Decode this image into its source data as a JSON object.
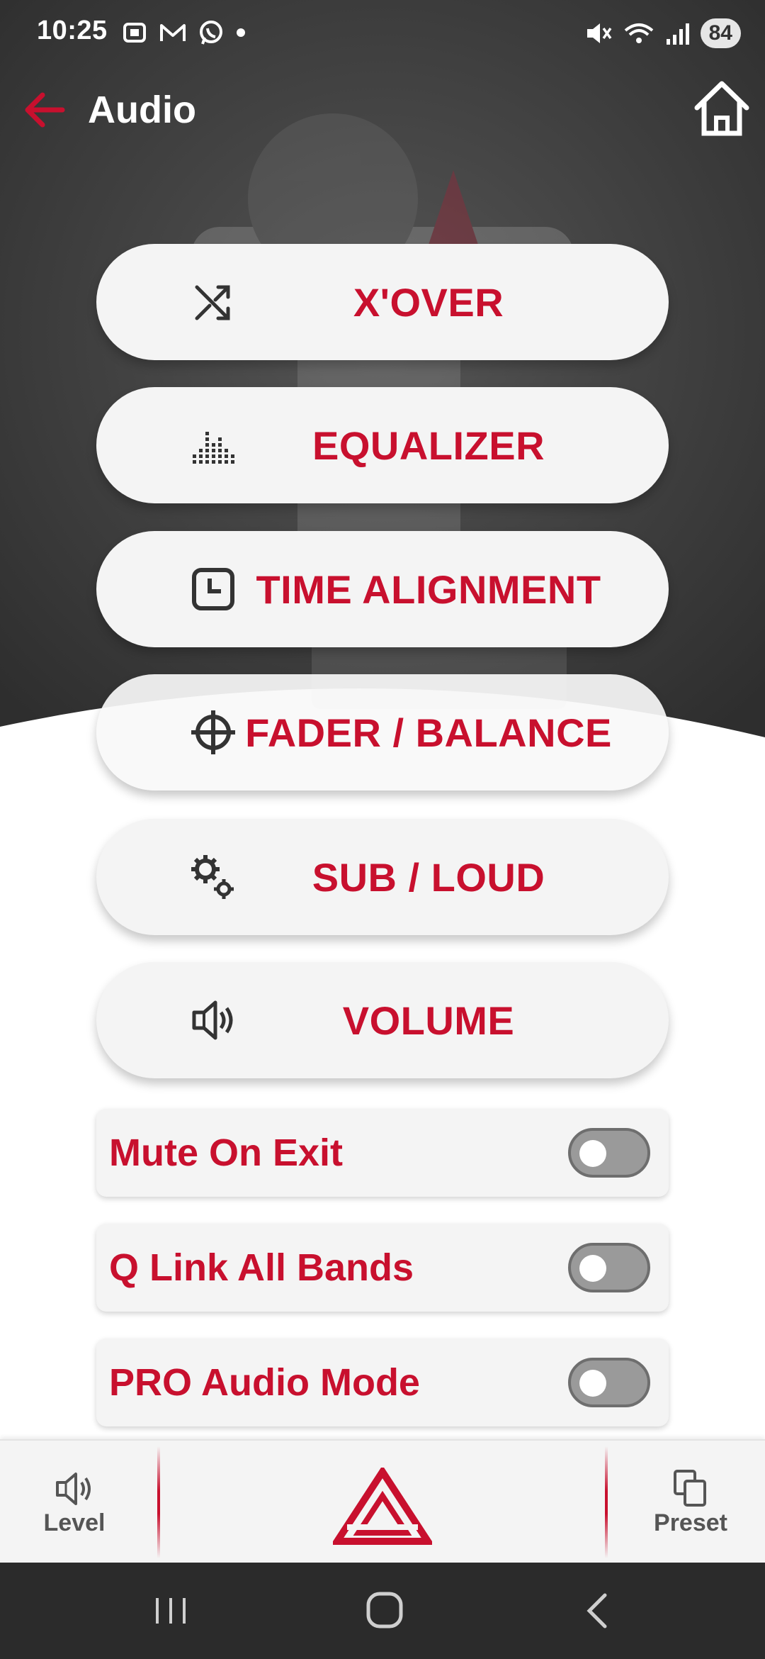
{
  "status_bar": {
    "time": "10:25",
    "battery": "84",
    "notification_icons": [
      "screenshot-icon",
      "gmail-icon",
      "whatsapp-icon",
      "dot-icon"
    ],
    "system_icons": [
      "mute-icon",
      "wifi-icon",
      "signal-icon"
    ]
  },
  "app_bar": {
    "title": "Audio",
    "back_icon": "back-arrow-icon",
    "home_icon": "home-icon"
  },
  "menu": [
    {
      "label": "X'OVER",
      "icon": "shuffle-icon"
    },
    {
      "label": "EQUALIZER",
      "icon": "equalizer-icon"
    },
    {
      "label": "TIME ALIGNMENT",
      "icon": "clock-icon"
    },
    {
      "label": "FADER / BALANCE",
      "icon": "crosshair-icon"
    },
    {
      "label": "SUB / LOUD",
      "icon": "gears-icon"
    },
    {
      "label": "VOLUME",
      "icon": "speaker-icon"
    }
  ],
  "toggles": [
    {
      "label": "Mute On Exit",
      "on": false
    },
    {
      "label": "Q Link All Bands",
      "on": false
    },
    {
      "label": "PRO Audio Mode",
      "on": false
    }
  ],
  "bottom_bar": {
    "level_label": "Level",
    "preset_label": "Preset",
    "center_icon": "triangle-logo-icon"
  },
  "nav_bar": {
    "recents_icon": "recents-icon",
    "home_icon": "nav-home-icon",
    "back_icon": "nav-back-icon"
  },
  "colors": {
    "accent": "#c8102e",
    "hero_background": "#3c3c3c",
    "card": "#f4f4f4",
    "toggle_off": "#9a9a9a"
  }
}
